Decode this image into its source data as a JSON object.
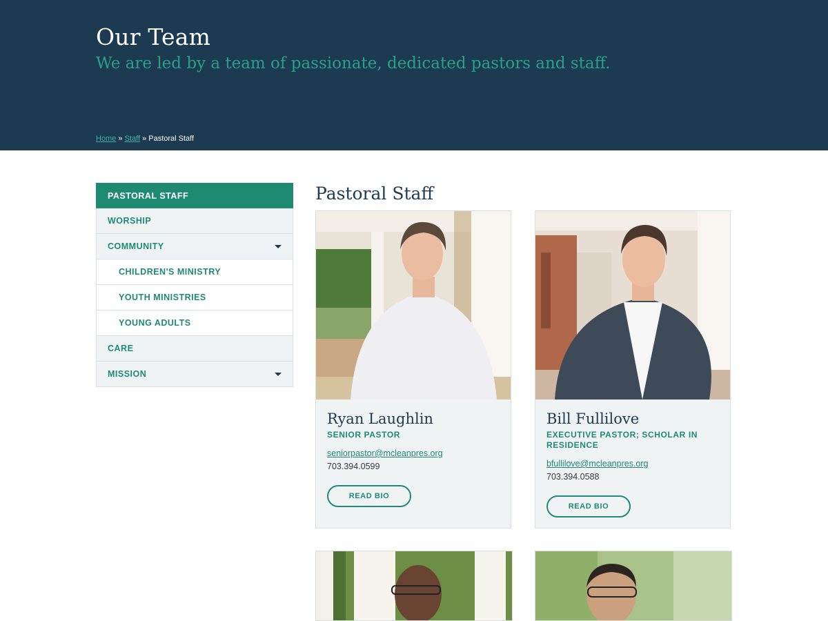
{
  "hero": {
    "title": "Our Team",
    "subtitle": "We are led by a team of passionate, dedicated pastors and staff."
  },
  "breadcrumb": {
    "home": "Home",
    "sep1": " » ",
    "staff": "Staff",
    "sep2": " » ",
    "current": "Pastoral Staff"
  },
  "sidebar": {
    "items": [
      {
        "label": "PASTORAL STAFF",
        "active": true
      },
      {
        "label": "WORSHIP"
      },
      {
        "label": "COMMUNITY",
        "icon": "chevron-down-icon"
      },
      {
        "label": "CHILDREN'S MINISTRY",
        "sub": true
      },
      {
        "label": "YOUTH MINISTRIES",
        "sub": true
      },
      {
        "label": "YOUNG ADULTS",
        "sub": true
      },
      {
        "label": "CARE"
      },
      {
        "label": "MISSION",
        "icon": "chevron-down-icon"
      }
    ]
  },
  "main": {
    "title": "Pastoral Staff",
    "staff": [
      {
        "name": "Ryan Laughlin",
        "role": "SENIOR PASTOR",
        "email": "seniorpastor@mcleanpres.org",
        "phone": "703.394.0599",
        "button": "READ BIO"
      },
      {
        "name": "Bill Fullilove",
        "role": "EXECUTIVE PASTOR; SCHOLAR IN RESIDENCE",
        "email": "bfullilove@mcleanpres.org",
        "phone": "703.394.0588",
        "button": "READ BIO"
      }
    ]
  },
  "colors": {
    "hero_bg": "#1c3b50",
    "accent": "#1f8a72",
    "subtitle": "#2aa08b",
    "card_bg": "#eff3f4"
  }
}
